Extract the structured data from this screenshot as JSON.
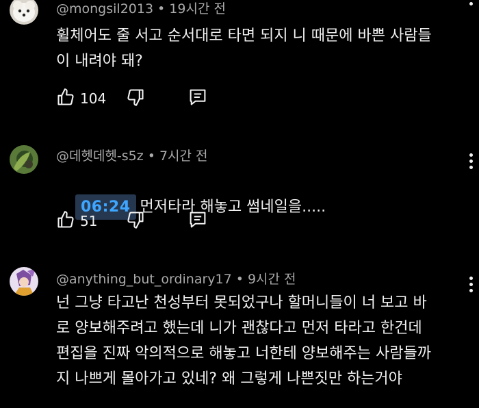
{
  "comments": [
    {
      "author": "@mongsil2013",
      "time": "19시간 전",
      "timestamp_link": "",
      "text": "휠체어도 줄 서고 순서대로 타면 되지 니 때문에 바쁜 사람들\n이 내려야 돼?",
      "likes": "104",
      "avatar_icon": "white-dog-avatar"
    },
    {
      "author": "@데헷데헷-s5z",
      "time": "7시간 전",
      "timestamp_link": "06:24",
      "text": "먼저타라 해놓고 썸네일을.....",
      "likes": "51",
      "avatar_icon": "green-nature-avatar"
    },
    {
      "author": "@anything_but_ordinary17",
      "time": "9시간 전",
      "timestamp_link": "",
      "text": "넌 그냥 타고난 천성부터 못되었구나 할머니들이 너 보고 바\n로 양보해주려고 했는데 니가 괜찮다고 먼저 타라고 한건데\n편집을 진짜 악의적으로 해놓고 너한테 양보해주는 사람들까\n지 나쁘게 몰아가고 있네? 왜 그렇게 나쁜짓만 하는거야",
      "likes": "",
      "avatar_icon": "anime-character-avatar"
    }
  ],
  "colors": {
    "background": "#000000",
    "meta": "#aaaaaa",
    "text": "#f1f1f1",
    "timestamp_fg": "#3ea6ff",
    "timestamp_bg": "#263850"
  }
}
